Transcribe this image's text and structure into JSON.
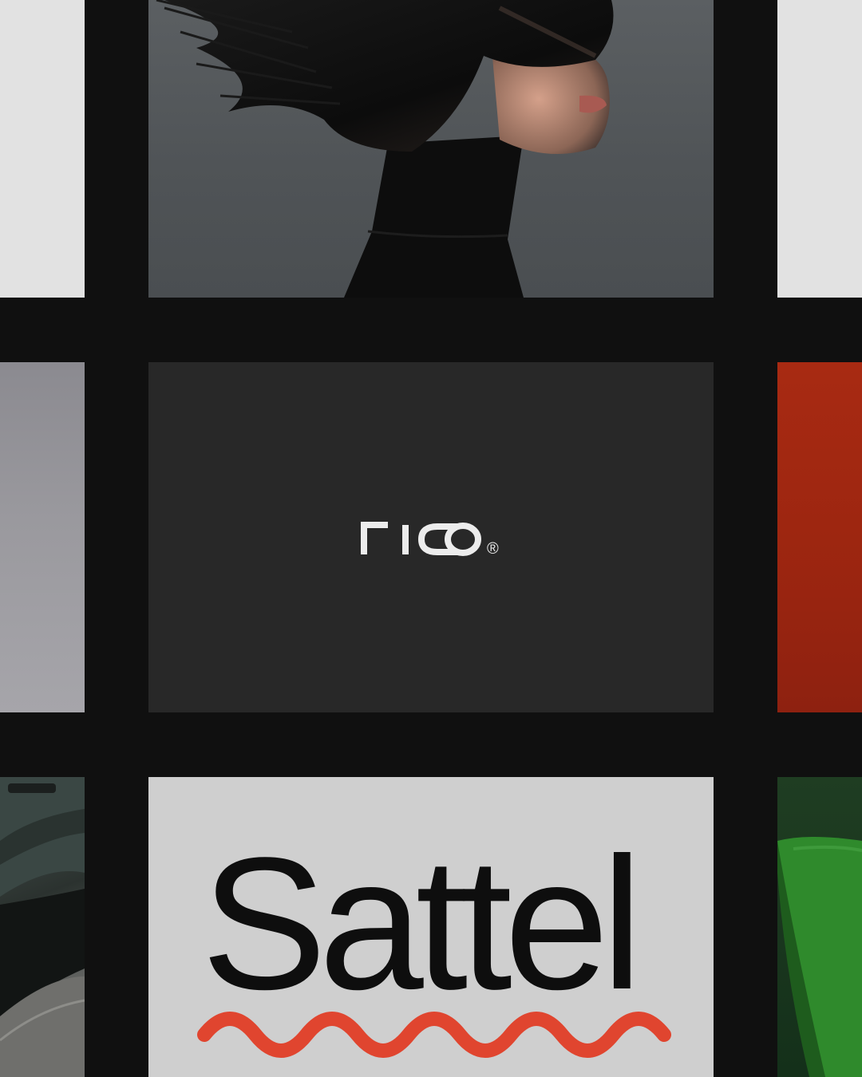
{
  "grid": {
    "background": "#101010",
    "tiles": {
      "r1_left": {
        "kind": "light-gray panel",
        "color": "#e2e2e2"
      },
      "r1_center": {
        "kind": "portrait photo",
        "color": "#55595c"
      },
      "r1_right": {
        "kind": "light-gray panel",
        "color": "#e2e2e2"
      },
      "r2_left": {
        "kind": "gray gradient panel",
        "color": "#9a999e"
      },
      "r2_center": {
        "kind": "logo card",
        "color": "#282828"
      },
      "r2_right": {
        "kind": "red panel",
        "color": "#a02812"
      },
      "r3_left": {
        "kind": "car detail photo",
        "color": "#3f4744"
      },
      "r3_center": {
        "kind": "wordmark card",
        "color": "#cfcfcf"
      },
      "r3_right": {
        "kind": "green fabric photo",
        "color": "#2e7a2a"
      }
    }
  },
  "rico_card": {
    "logo_text": "rico",
    "registered_mark": "®",
    "text_color": "#ececec"
  },
  "sattel_card": {
    "wordmark": "Sattel",
    "text_color": "#0e0e0e",
    "squiggle_color": "#e0452f"
  }
}
